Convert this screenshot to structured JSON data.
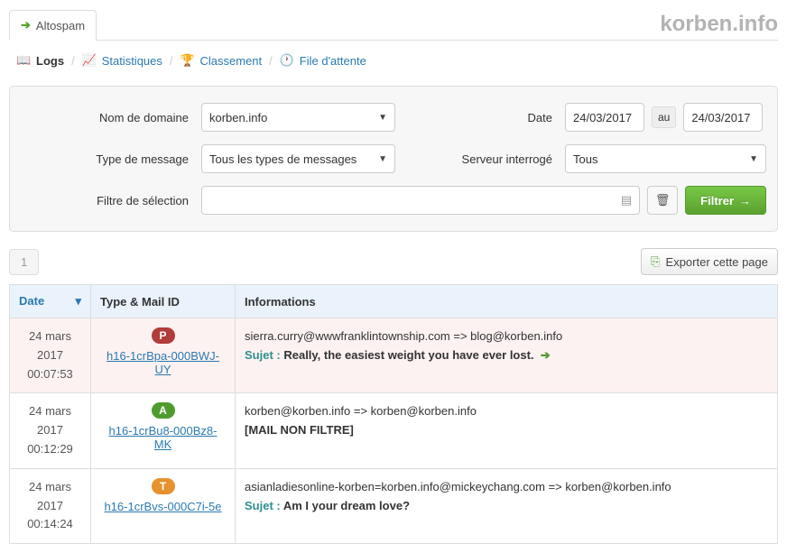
{
  "header": {
    "tab_label": "Altospam",
    "brand": "korben.info"
  },
  "nav": {
    "logs": "Logs",
    "stats": "Statistiques",
    "classement": "Classement",
    "file": "File d'attente"
  },
  "form": {
    "domain_label": "Nom de domaine",
    "domain_value": "korben.info",
    "date_label": "Date",
    "date_from": "24/03/2017",
    "date_sep": "au",
    "date_to": "24/03/2017",
    "type_label": "Type de message",
    "type_value": "Tous les types de messages",
    "server_label": "Serveur interrogé",
    "server_value": "Tous",
    "filter_label": "Filtre de sélection",
    "filter_value": "",
    "filter_button": "Filtrer"
  },
  "pager": {
    "page": "1",
    "export_label": "Exporter cette page"
  },
  "table": {
    "headers": {
      "date": "Date",
      "type": "Type & Mail ID",
      "info": "Informations"
    },
    "rows": [
      {
        "date": "24 mars 2017",
        "time": "00:07:53",
        "badge": "P",
        "mailid": "h16-1crBpa-000BWJ-UY",
        "line1": "sierra.curry@wwwfranklintownship.com => blog@korben.info",
        "sujet_label": "Sujet :",
        "sujet": "Really, the easiest weight you have ever lost.",
        "pink": true,
        "arrow": true
      },
      {
        "date": "24 mars 2017",
        "time": "00:12:29",
        "badge": "A",
        "mailid": "h16-1crBu8-000Bz8-MK",
        "line1": "korben@korben.info => korben@korben.info",
        "sujet_label": "",
        "sujet": "[MAIL NON FILTRE]",
        "pink": false,
        "arrow": false
      },
      {
        "date": "24 mars 2017",
        "time": "00:14:24",
        "badge": "T",
        "mailid": "h16-1crBvs-000C7i-5e",
        "line1": "asianladiesonline-korben=korben.info@mickeychang.com => korben@korben.info",
        "sujet_label": "Sujet :",
        "sujet": "Am I your dream love?",
        "pink": false,
        "arrow": false
      }
    ]
  }
}
